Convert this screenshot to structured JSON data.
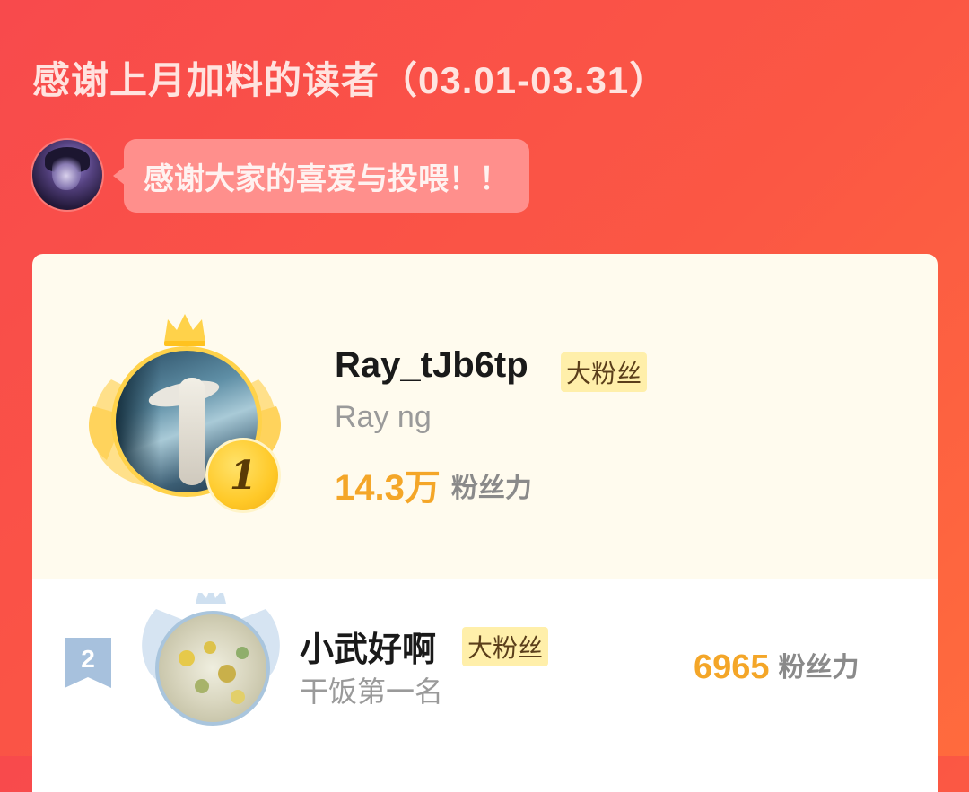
{
  "header": {
    "title": "感谢上月加料的读者（03.01-03.31）"
  },
  "author": {
    "message": "感谢大家的喜爱与投喂！！"
  },
  "ranking": [
    {
      "rank": "1",
      "name": "Ray_tJb6tp",
      "tag": "大粉丝",
      "subtitle": "Ray ng",
      "power_value": "14.3万",
      "power_unit": "粉丝力"
    },
    {
      "rank": "2",
      "name": "小武好啊",
      "tag": "大粉丝",
      "subtitle": "干饭第一名",
      "power_value": "6965",
      "power_unit": "粉丝力"
    }
  ],
  "colors": {
    "background": "#f84a4c",
    "gold": "#f4a628",
    "tag_bg": "#ffefaa",
    "card_bg": "#fffbee"
  },
  "icons": [
    "crown-icon",
    "wings-icon",
    "rank-1-medal-icon",
    "rank-2-ribbon-icon"
  ]
}
